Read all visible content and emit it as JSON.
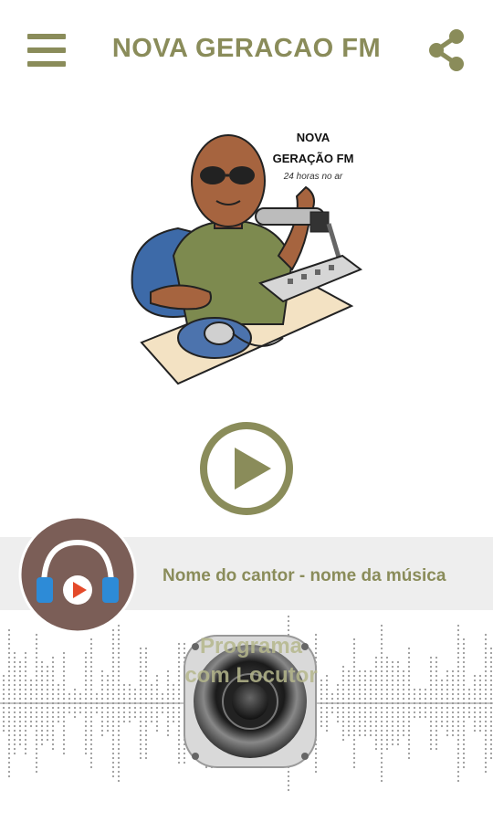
{
  "header": {
    "title": "NOVA GERACAO FM",
    "menu_icon": "hamburger-menu-icon",
    "share_icon": "share-icon"
  },
  "logo": {
    "line1": "NOVA",
    "line2": "GERAÇÃO FM",
    "tagline": "24 horas no ar"
  },
  "player": {
    "play_icon": "play-icon",
    "track_info": "Nome do cantor - nome da música"
  },
  "program": {
    "line1": "Programa",
    "line2": "com Locutor"
  },
  "colors": {
    "accent": "#8a8c5a",
    "badge": "#7b5e57",
    "bar": "#eeeeee"
  }
}
